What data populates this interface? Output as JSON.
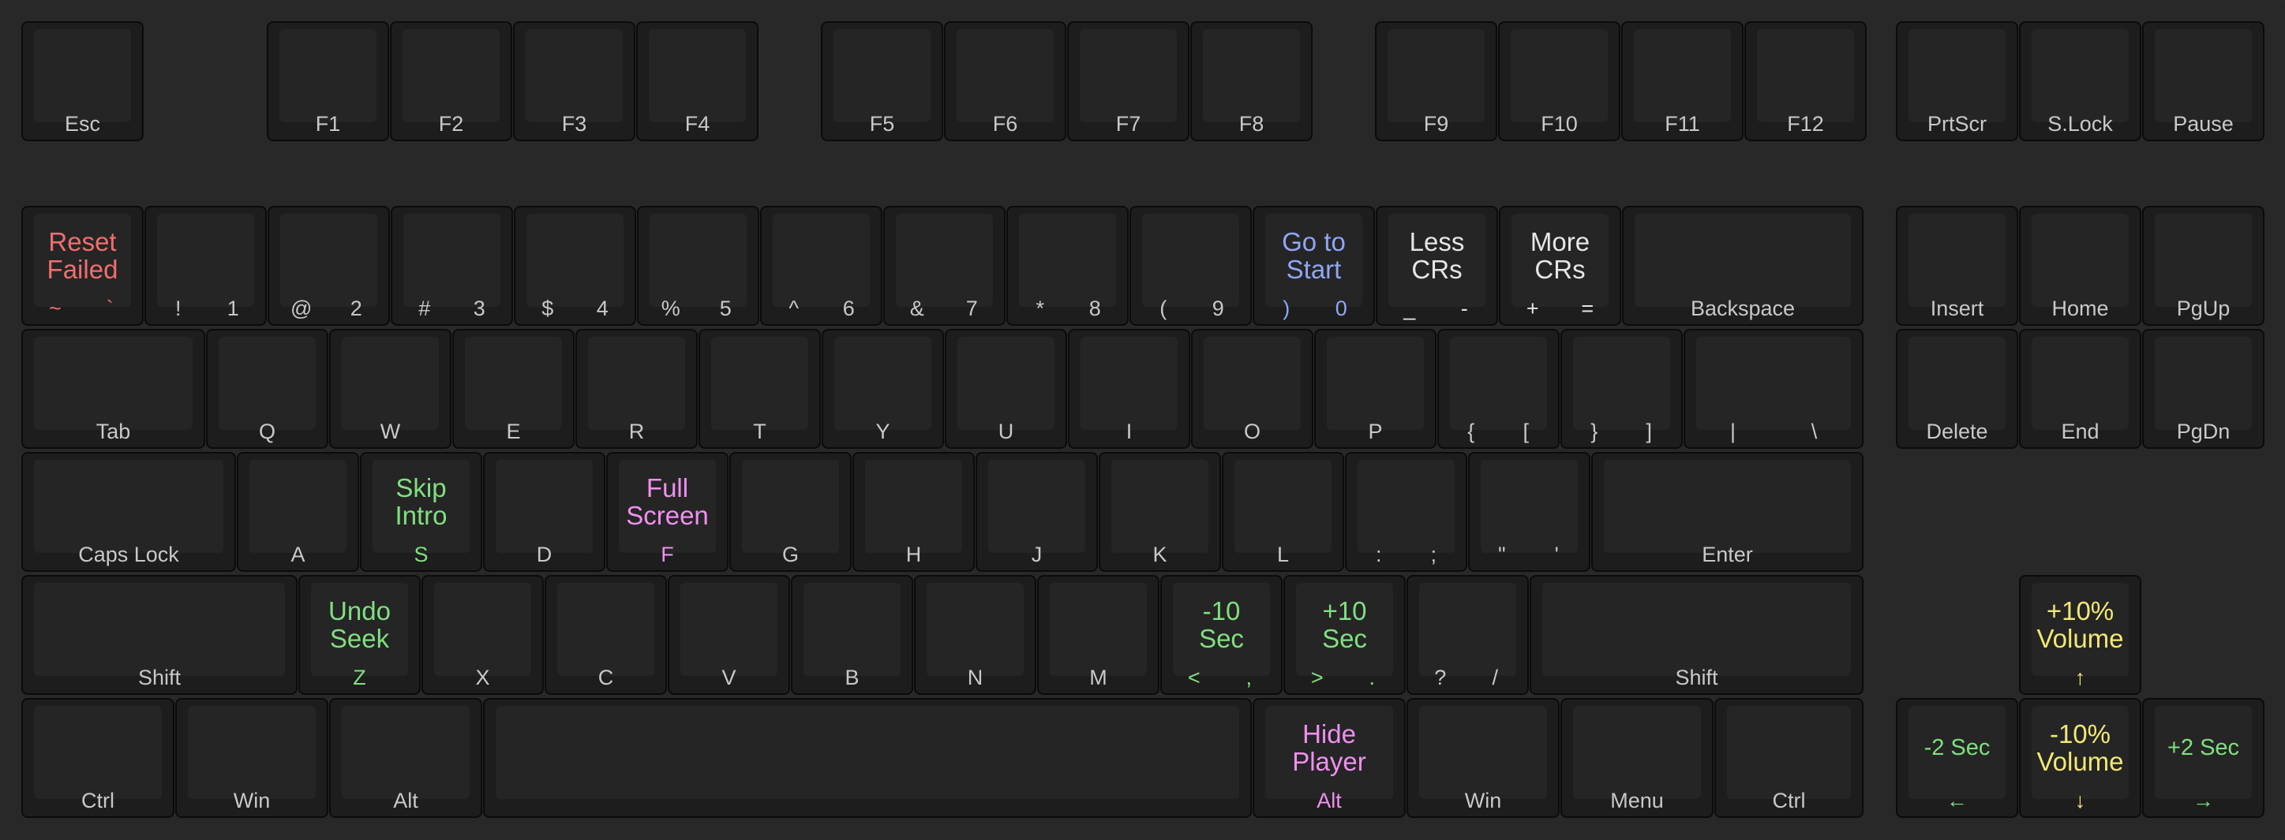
{
  "colors": {
    "red": "#f06e6e",
    "blue": "#8fa6f5",
    "green": "#7fe07f",
    "magenta": "#f08ff0",
    "yellow": "#f2e873",
    "white": "#e6e6e6",
    "legend": "#c8c8c8"
  },
  "keys": {
    "esc": {
      "label": "Esc"
    },
    "f1": {
      "label": "F1"
    },
    "f2": {
      "label": "F2"
    },
    "f3": {
      "label": "F3"
    },
    "f4": {
      "label": "F4"
    },
    "f5": {
      "label": "F5"
    },
    "f6": {
      "label": "F6"
    },
    "f7": {
      "label": "F7"
    },
    "f8": {
      "label": "F8"
    },
    "f9": {
      "label": "F9"
    },
    "f10": {
      "label": "F10"
    },
    "f11": {
      "label": "F11"
    },
    "f12": {
      "label": "F12"
    },
    "prtscr": {
      "label": "PrtScr"
    },
    "slock": {
      "label": "S.Lock"
    },
    "pause": {
      "label": "Pause"
    },
    "backtick": {
      "shift": "~",
      "base": "`",
      "func": "Reset\nFailed",
      "color": "red"
    },
    "n1": {
      "shift": "!",
      "base": "1"
    },
    "n2": {
      "shift": "@",
      "base": "2"
    },
    "n3": {
      "shift": "#",
      "base": "3"
    },
    "n4": {
      "shift": "$",
      "base": "4"
    },
    "n5": {
      "shift": "%",
      "base": "5"
    },
    "n6": {
      "shift": "^",
      "base": "6"
    },
    "n7": {
      "shift": "&",
      "base": "7"
    },
    "n8": {
      "shift": "*",
      "base": "8"
    },
    "n9": {
      "shift": "(",
      "base": "9"
    },
    "n0": {
      "shift": ")",
      "base": "0",
      "func": "Go to\nStart",
      "color": "blue"
    },
    "minus": {
      "shift": "_",
      "base": "-",
      "func": "Less\nCRs",
      "color": "white"
    },
    "equals": {
      "shift": "+",
      "base": "=",
      "func": "More\nCRs",
      "color": "white"
    },
    "backspace": {
      "label": "Backspace"
    },
    "insert": {
      "label": "Insert"
    },
    "home": {
      "label": "Home"
    },
    "pgup": {
      "label": "PgUp"
    },
    "tab": {
      "label": "Tab"
    },
    "q": {
      "label": "Q"
    },
    "w": {
      "label": "W"
    },
    "e": {
      "label": "E"
    },
    "r": {
      "label": "R"
    },
    "t": {
      "label": "T"
    },
    "y": {
      "label": "Y"
    },
    "u": {
      "label": "U"
    },
    "i": {
      "label": "I"
    },
    "o": {
      "label": "O"
    },
    "p": {
      "label": "P"
    },
    "lbracket": {
      "shift": "{",
      "base": "["
    },
    "rbracket": {
      "shift": "}",
      "base": "]"
    },
    "backslash": {
      "shift": "|",
      "base": "\\"
    },
    "delete": {
      "label": "Delete"
    },
    "end": {
      "label": "End"
    },
    "pgdn": {
      "label": "PgDn"
    },
    "capslock": {
      "label": "Caps Lock"
    },
    "a": {
      "label": "A"
    },
    "s": {
      "label": "S",
      "func": "Skip\nIntro",
      "color": "green"
    },
    "d": {
      "label": "D"
    },
    "f": {
      "label": "F",
      "func": "Full\nScreen",
      "color": "magenta"
    },
    "g": {
      "label": "G"
    },
    "h": {
      "label": "H"
    },
    "j": {
      "label": "J"
    },
    "k": {
      "label": "K"
    },
    "l": {
      "label": "L"
    },
    "semicolon": {
      "shift": ":",
      "base": ";"
    },
    "quote": {
      "shift": "\"",
      "base": "'"
    },
    "enter": {
      "label": "Enter"
    },
    "lshift": {
      "label": "Shift"
    },
    "z": {
      "label": "Z",
      "func": "Undo\nSeek",
      "color": "green"
    },
    "x": {
      "label": "X"
    },
    "c": {
      "label": "C"
    },
    "v": {
      "label": "V"
    },
    "b": {
      "label": "B"
    },
    "n": {
      "label": "N"
    },
    "m": {
      "label": "M"
    },
    "comma": {
      "shift": "<",
      "base": ",",
      "func": "-10\nSec",
      "color": "green"
    },
    "period": {
      "shift": ">",
      "base": ".",
      "func": "+10\nSec",
      "color": "green"
    },
    "slash": {
      "shift": "?",
      "base": "/"
    },
    "rshift": {
      "label": "Shift"
    },
    "up": {
      "label": "↑",
      "func": "+10%\nVolume",
      "color": "yellow"
    },
    "lctrl": {
      "label": "Ctrl"
    },
    "lwin": {
      "label": "Win"
    },
    "lalt": {
      "label": "Alt"
    },
    "space": {
      "label": ""
    },
    "ralt": {
      "label": "Alt",
      "func": "Hide\nPlayer",
      "color": "magenta"
    },
    "rwin": {
      "label": "Win"
    },
    "menu": {
      "label": "Menu"
    },
    "rctrl": {
      "label": "Ctrl"
    },
    "left": {
      "label": "←",
      "func": "-2 Sec",
      "color": "green"
    },
    "down": {
      "label": "↓",
      "func": "-10%\nVolume",
      "color": "yellow"
    },
    "right": {
      "label": "→",
      "func": "+2 Sec",
      "color": "green"
    }
  }
}
